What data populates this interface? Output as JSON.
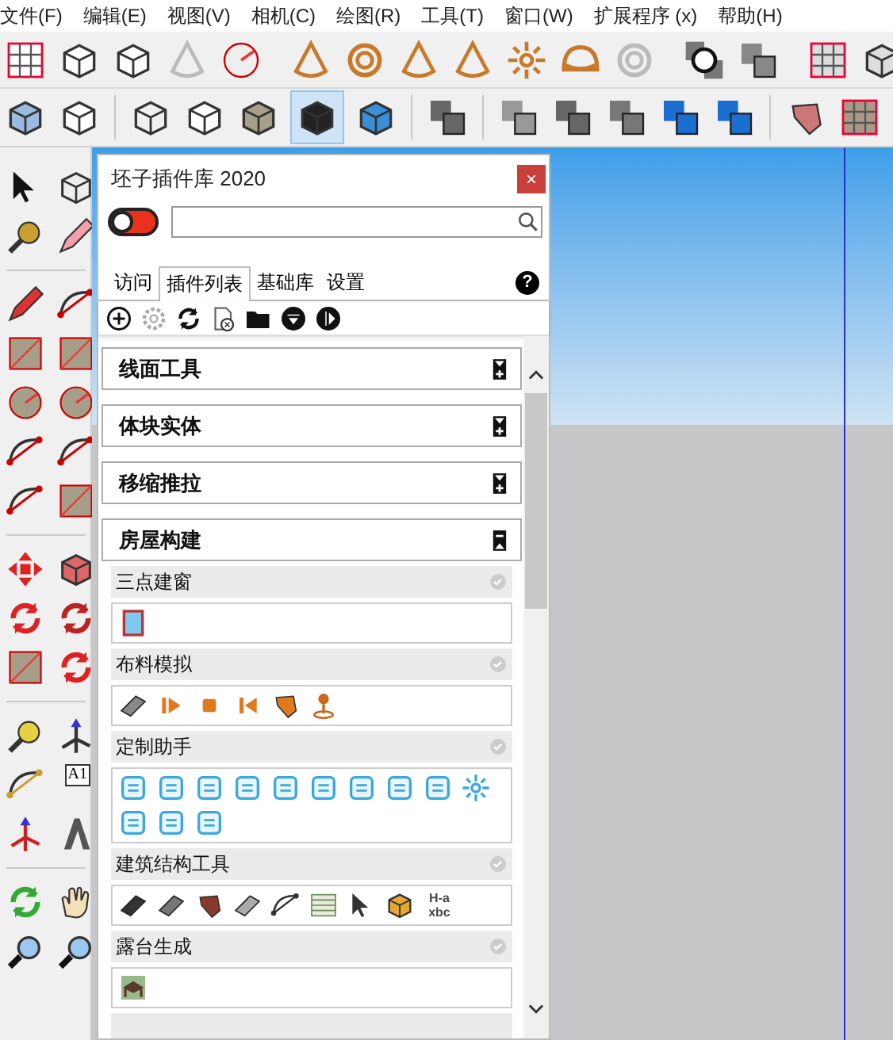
{
  "menu_bar": [
    "文件(F)",
    "编辑(E)",
    "视图(V)",
    "相机(C)",
    "绘图(R)",
    "工具(T)",
    "窗口(W)",
    "扩展程序 (x)",
    "帮助(H)"
  ],
  "left_toolbar": {
    "text_tool_label": "A1"
  },
  "panel": {
    "title": "坯子插件库 2020",
    "close": "×",
    "switch": {
      "on": false
    },
    "tabs": [
      {
        "label": "访问",
        "selected": false
      },
      {
        "label": "插件列表",
        "selected": true
      },
      {
        "label": "基础库",
        "selected": false
      },
      {
        "label": "设置",
        "selected": false
      }
    ],
    "help": "?",
    "categories": [
      {
        "title": "线面工具",
        "expanded": false
      },
      {
        "title": "体块实体",
        "expanded": false
      },
      {
        "title": "移缩推拉",
        "expanded": false
      },
      {
        "title": "房屋构建",
        "expanded": true,
        "plugins": [
          {
            "title": "三点建窗"
          },
          {
            "title": "布料模拟"
          },
          {
            "title": "定制助手"
          },
          {
            "title": "建筑结构工具",
            "icon_text": "H-a xbc"
          },
          {
            "title": "露台生成"
          }
        ]
      }
    ]
  }
}
